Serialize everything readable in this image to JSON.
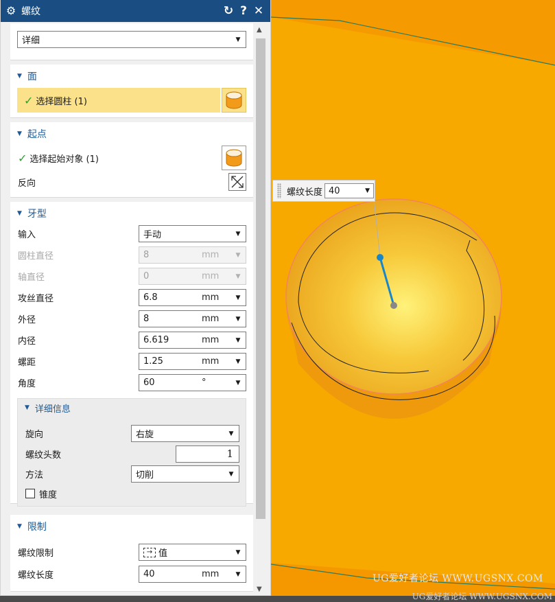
{
  "dialog": {
    "title": "螺纹",
    "reset_icon": "↻",
    "help_icon": "?",
    "close_icon": "✕",
    "gear_icon": "⚙"
  },
  "type_select": {
    "value": "详细"
  },
  "face_section": {
    "title": "面",
    "select_label": "选择圆柱 (1)"
  },
  "start_section": {
    "title": "起点",
    "select_label": "选择起始对象 (1)",
    "reverse_label": "反向"
  },
  "profile_section": {
    "title": "牙型",
    "rows": [
      {
        "label": "输入",
        "value": "手动",
        "unit": "",
        "disabled": false
      },
      {
        "label": "圆柱直径",
        "value": "8",
        "unit": "mm",
        "disabled": true
      },
      {
        "label": "轴直径",
        "value": "0",
        "unit": "mm",
        "disabled": true
      },
      {
        "label": "攻丝直径",
        "value": "6.8",
        "unit": "mm",
        "disabled": false
      },
      {
        "label": "外径",
        "value": "8",
        "unit": "mm",
        "disabled": false
      },
      {
        "label": "内径",
        "value": "6.619",
        "unit": "mm",
        "disabled": false
      },
      {
        "label": "螺距",
        "value": "1.25",
        "unit": "mm",
        "disabled": false
      },
      {
        "label": "角度",
        "value": "60",
        "unit": "°",
        "disabled": false
      }
    ],
    "details": {
      "title": "详细信息",
      "handedness_label": "旋向",
      "handedness_value": "右旋",
      "starts_label": "螺纹头数",
      "starts_value": "1",
      "method_label": "方法",
      "method_value": "切削",
      "taper_label": "锥度"
    }
  },
  "limits_section": {
    "title": "限制",
    "limit_label": "螺纹限制",
    "limit_value": "值",
    "length_label": "螺纹长度",
    "length_value": "40",
    "length_unit": "mm"
  },
  "viewport_popup": {
    "label": "螺纹长度",
    "value": "40"
  },
  "watermark": "UG爱好者论坛 WWW.UGSNX.COM",
  "bottom_watermark": "UG爱好者论坛 WWW.UGSNX.COM",
  "colors": {
    "titlebar": "#1a4e83",
    "section": "#1f5a96",
    "highlight": "#fbe18a",
    "model": "#f5a300",
    "arrow": "#e01818"
  }
}
